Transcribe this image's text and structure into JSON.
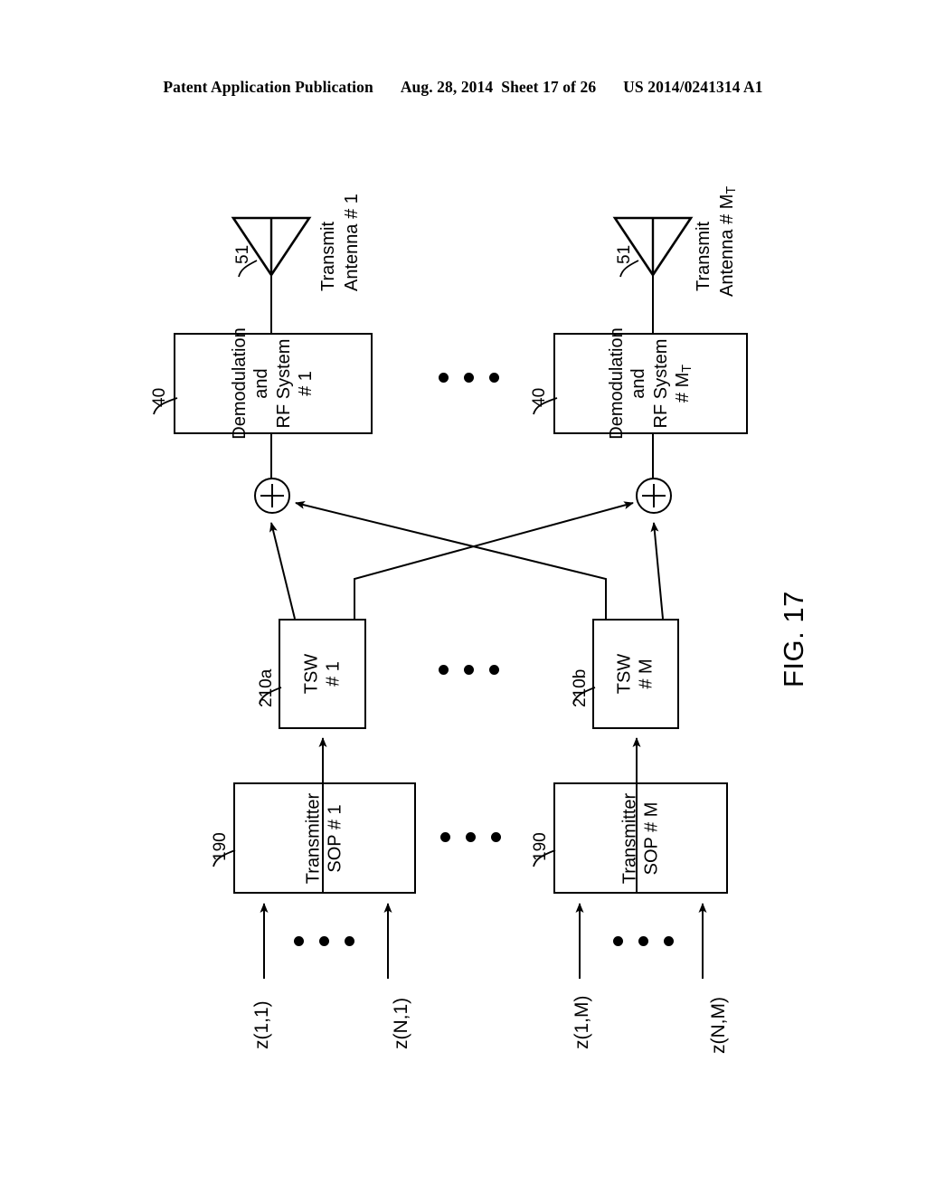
{
  "header": {
    "publication": "Patent Application Publication",
    "date": "Aug. 28, 2014",
    "sheet": "Sheet 17 of 26",
    "patent_number": "US 2014/0241314 A1"
  },
  "figure": {
    "caption": "FIG. 17",
    "antennas": [
      {
        "ref": "51",
        "label_line1": "Transmit",
        "label_line2": "Antenna # 1"
      },
      {
        "ref": "51",
        "label_line1": "Transmit",
        "label_line2": "Antenna # M",
        "label_sub": "T"
      }
    ],
    "demod_blocks": [
      {
        "ref": "40",
        "line1": "Demodulation",
        "line2": "and",
        "line3": "RF System",
        "line4": "# 1"
      },
      {
        "ref": "40",
        "line1": "Demodulation",
        "line2": "and",
        "line3": "RF System",
        "line4": "# M",
        "line4_sub": "T"
      }
    ],
    "summers": [
      {
        "symbol": "+"
      },
      {
        "symbol": "+"
      }
    ],
    "tsw_blocks": [
      {
        "ref": "210a",
        "line1": "TSW",
        "line2": "# 1"
      },
      {
        "ref": "210b",
        "line1": "TSW",
        "line2": "# M"
      }
    ],
    "sop_blocks": [
      {
        "ref": "190",
        "line1": "Transmitter",
        "line2": "SOP # 1"
      },
      {
        "ref": "190",
        "line1": "Transmitter",
        "line2": "SOP # M"
      }
    ],
    "input_signals": [
      "z(1,1)",
      "z(N,1)",
      "z(1,M)",
      "z(N,M)"
    ],
    "ellipsis": "• • •",
    "colors": {
      "ink": "#000000",
      "paper": "#ffffff"
    }
  }
}
